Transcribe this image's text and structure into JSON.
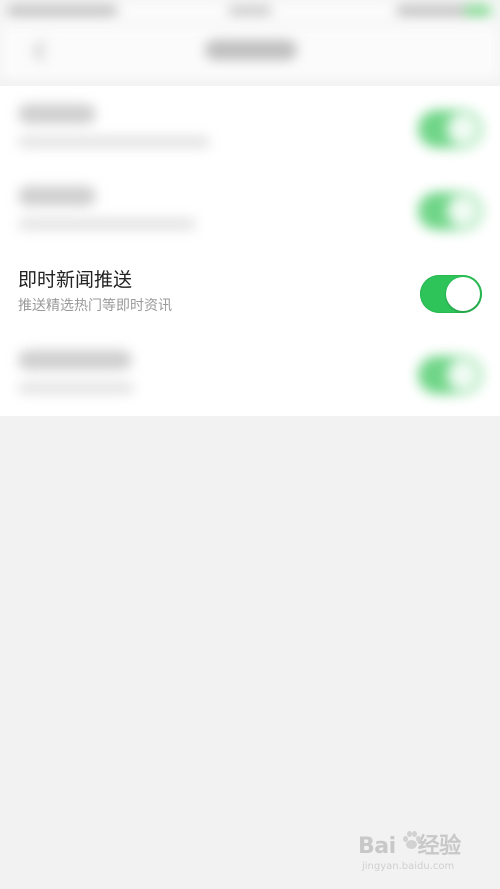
{
  "row_focus": {
    "title": "即时新闻推送",
    "subtitle": "推送精选热门等即时资讯",
    "toggle_on": true
  },
  "watermark": {
    "logo": "Bai 经验",
    "url": "jingyan.baidu.com"
  },
  "colors": {
    "toggle_on": "#2ec45a",
    "background": "#f2f2f2",
    "list_background": "#ffffff"
  },
  "icons": {
    "back": "chevron-left-icon",
    "watermark": "baidu-paw-icon"
  }
}
